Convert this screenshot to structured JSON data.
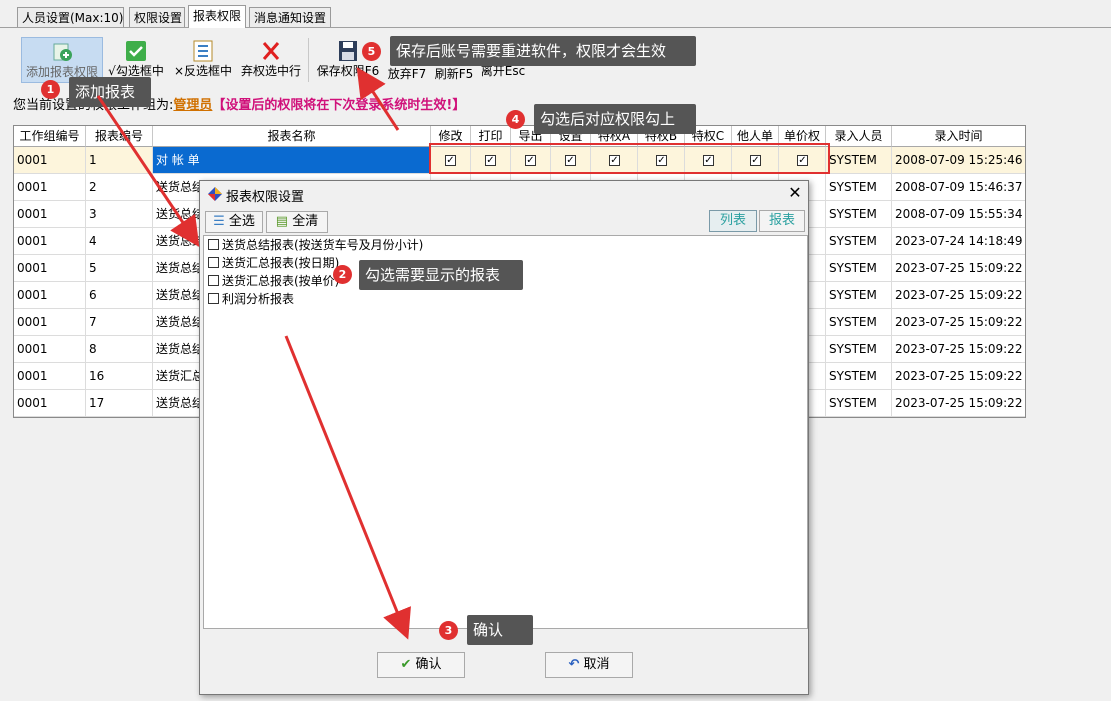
{
  "tabs": [
    "人员设置(Max:10)",
    "权限设置",
    "报表权限",
    "消息通知设置"
  ],
  "toolbar": {
    "add": "添加报表权限",
    "check": "√勾选框中",
    "invert": "×反选框中",
    "drop": "弃权选中行",
    "save": "保存权限F6",
    "discard": "放弃F7",
    "refresh": "刷新F5",
    "leave": "离开Esc"
  },
  "notice": {
    "prefix": "您当前设置的权限工作组为:",
    "role": "管理员",
    "warning": "【设置后的权限将在下次登录系统时生效!】"
  },
  "grid": {
    "headers": [
      "工作组编号",
      "报表编号",
      "报表名称",
      "修改",
      "打印",
      "导出",
      "设置",
      "特权A",
      "特权B",
      "特权C",
      "他人单",
      "单价权",
      "录入人员",
      "录入时间"
    ],
    "rows": [
      {
        "group": "0001",
        "id": "1",
        "name": "对 帐 单",
        "user": "SYSTEM",
        "time": "2008-07-09 15:25:46"
      },
      {
        "group": "0001",
        "id": "2",
        "name": "送货总结",
        "user": "SYSTEM",
        "time": "2008-07-09 15:46:37"
      },
      {
        "group": "0001",
        "id": "3",
        "name": "送货总结",
        "user": "SYSTEM",
        "time": "2008-07-09 15:55:34"
      },
      {
        "group": "0001",
        "id": "4",
        "name": "送货总结",
        "user": "SYSTEM",
        "time": "2023-07-24 14:18:49"
      },
      {
        "group": "0001",
        "id": "5",
        "name": "送货总结",
        "user": "SYSTEM",
        "time": "2023-07-25 15:09:22"
      },
      {
        "group": "0001",
        "id": "6",
        "name": "送货总结",
        "user": "SYSTEM",
        "time": "2023-07-25 15:09:22"
      },
      {
        "group": "0001",
        "id": "7",
        "name": "送货总结",
        "user": "SYSTEM",
        "time": "2023-07-25 15:09:22"
      },
      {
        "group": "0001",
        "id": "8",
        "name": "送货总结",
        "user": "SYSTEM",
        "time": "2023-07-25 15:09:22"
      },
      {
        "group": "0001",
        "id": "16",
        "name": "送货汇总",
        "user": "SYSTEM",
        "time": "2023-07-25 15:09:22"
      },
      {
        "group": "0001",
        "id": "17",
        "name": "送货总结",
        "user": "SYSTEM",
        "time": "2023-07-25 15:09:22"
      }
    ],
    "check_mark": "✓"
  },
  "dialog": {
    "title": "报表权限设置",
    "select_all": "全选",
    "clear_all": "全清",
    "view_list": "列表",
    "view_report": "报表",
    "items": [
      "送货总结报表(按送货车号及月份小计)",
      "送货汇总报表(按日期)",
      "送货汇总报表(按单价)",
      "利润分析报表"
    ],
    "ok": "确认",
    "cancel": "取消",
    "close": "✕"
  },
  "annotations": [
    {
      "n": "1",
      "text": "添加报表"
    },
    {
      "n": "2",
      "text": "勾选需要显示的报表"
    },
    {
      "n": "3",
      "text": "确认"
    },
    {
      "n": "4",
      "text": "勾选后对应权限勾上"
    },
    {
      "n": "5",
      "text": "保存后账号需要重进软件，权限才会生效"
    }
  ],
  "colors": {
    "annotation_red": "#e03030",
    "callout_bg": "#555555",
    "selected_blue": "#0a6ad0"
  }
}
